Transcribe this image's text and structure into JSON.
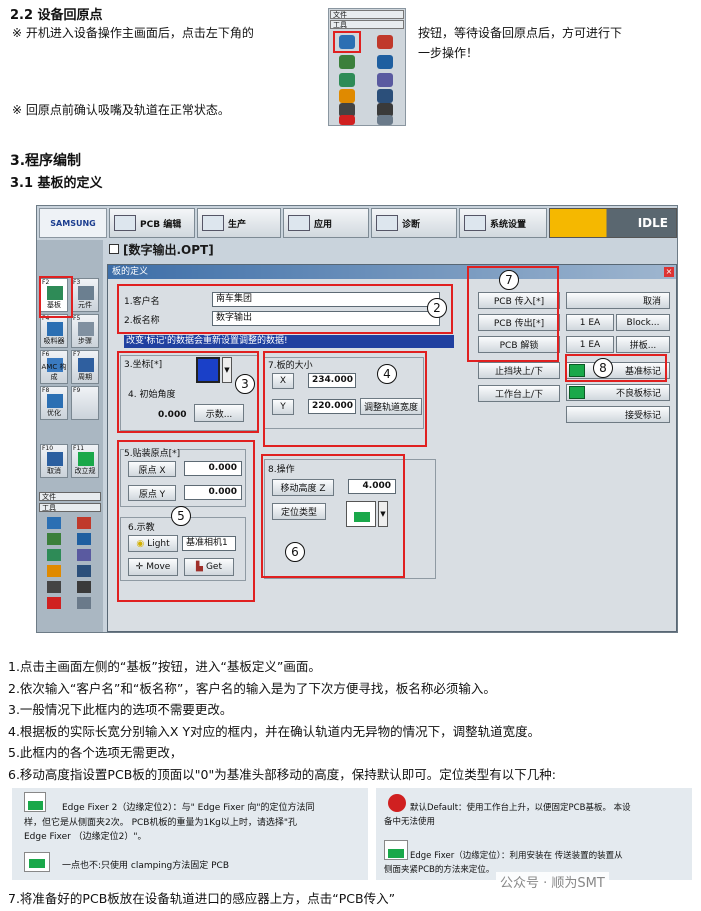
{
  "s22": {
    "title": "2.2 设备回原点",
    "p1_a": "※  开机进入设备操作主画面后，点击左下角的",
    "p1_b": "按钮，等待设备回原点后，方可进行下",
    "p1_c": "一步操作！",
    "p2": "※  回原点前确认吸嘴及轨道在正常状态。",
    "toolbar": {
      "menu1": "文件",
      "menu2": "工具"
    }
  },
  "s3": {
    "title": "3.程序编制",
    "sub": "3.1 基板的定义"
  },
  "screen": {
    "brand": "SAMSUNG",
    "tabs": [
      "PCB 编辑",
      "生产",
      "应用",
      "诊断",
      "系统设置"
    ],
    "status": "IDLE",
    "file_title": "[数字输出.OPT]",
    "dialog_title": "板的定义",
    "side_buttons": [
      {
        "key": "F2",
        "label": "基板"
      },
      {
        "key": "F3",
        "label": "元件"
      },
      {
        "key": "F4",
        "label": "吸料器"
      },
      {
        "key": "F5",
        "label": "步骤"
      },
      {
        "key": "F6",
        "label": "AMC 构成"
      },
      {
        "key": "F7",
        "label": "周期"
      },
      {
        "key": "F8",
        "label": "优化"
      },
      {
        "key": "F9",
        "label": ""
      },
      {
        "key": "F10",
        "label": "取消"
      },
      {
        "key": "F11",
        "label": "改立规"
      }
    ],
    "side_menu1": "文件",
    "side_menu2": "工具",
    "customer_label": "1.客户名",
    "customer_value": "南车集团",
    "board_label": "2.板名称",
    "board_value": "数字输出",
    "warning": "改变'标记'的数据会重新设置调整的数据!",
    "coord_label": "3.坐标[*]",
    "angle_label": "4. 初始角度",
    "angle_value": "0.000",
    "show_btn": "示数...",
    "size_label": "7.板的大小",
    "x_label": "X",
    "x_value": "234.000",
    "y_label": "Y",
    "y_value": "220.000",
    "adjust_width_btn": "调整轨道宽度",
    "origin_label": "5.贴装原点[*]",
    "origin_x_label": "原点 X",
    "origin_x_value": "0.000",
    "origin_y_label": "原点 Y",
    "origin_y_value": "0.000",
    "display_label": "6.示教",
    "light_btn": "Light",
    "camera_select": "基准相机1",
    "move_btn": "Move",
    "get_btn": "Get",
    "op_label": "8.操作",
    "move_height_label": "移动高度 Z",
    "move_height_value": "4.000",
    "locate_label": "定位类型",
    "pcb_in_btn": "PCB 传入[*]",
    "pcb_out_btn": "PCB 传出[*]",
    "pcb_unlock_btn": "PCB 解锁",
    "stopper_btn": "止挡块上/下",
    "table_btn": "工作台上/下",
    "cancel_btn": "取消",
    "block_count1": "1 EA",
    "block_btn": "Block...",
    "block_count2": "1 EA",
    "split_btn": "拼板...",
    "fiducial_btn": "基准标记",
    "bad_mark_btn": "不良板标记",
    "accept_mark_btn": "接受标记",
    "callouts": [
      "1",
      "2",
      "3",
      "4",
      "5",
      "6",
      "7",
      "8"
    ]
  },
  "steps": [
    "1.点击主画面左侧的“基板”按钮，进入“基板定义”画面。",
    "2.依次输入“客户名”和“板名称”，客户名的输入是为了下次方便寻找，板名称必须输入。",
    "3.一般情况下此框内的选项不需要更改。",
    "4.根据板的实际长宽分别输入X Y对应的框内，并在确认轨道内无异物的情况下，调整轨道宽度。",
    "5.此框内的各个选项无需更改，",
    "6.移动高度指设置PCB板的顶面以\"0\"为基准头部移动的高度，保持默认即可。定位类型有以下几种:"
  ],
  "fixers": {
    "a1": "Edge Fixer 2（边缘定位2）：与\" Edge Fixer 向\"的定位方法同",
    "a2": "样，但它是从侧面夹2次。 PCB机板的重量为1Kg以上时，请选择\"孔",
    "a3": "Edge Fixer （边缘定位2）\"。",
    "b1": "默认Default：使用工作台上升，以便固定PCB基板。 本设",
    "b2": "备中无法使用",
    "c1": "一点也不:只使用  clamping方法固定  PCB",
    "d1": "Edge Fixer（边缘定位）：利用安装在 传送装置的装置从",
    "d2": "侧面夹紧PCB的方法来定位。"
  },
  "step7": "7.将准备好的PCB板放在设备轨道进口的感应器上方，点击“PCB传入”",
  "watermark": "公众号 · 顺为SMT",
  "colors": {
    "accent_red": "#e02020",
    "pcb_green": "#1aa84a",
    "idle_bar": "#5a6770",
    "highlight": "#2040a0"
  }
}
